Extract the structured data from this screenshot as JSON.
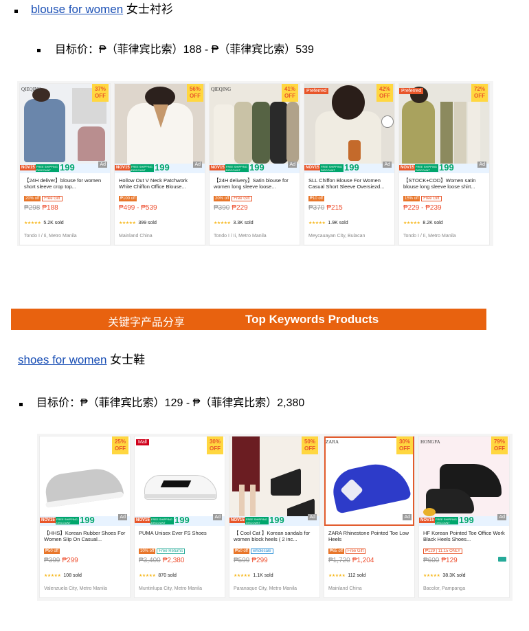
{
  "section1": {
    "link": "blouse for women",
    "title_cn": " 女士衬衫",
    "target": "目标价：₱（菲律宾比索）188 - ₱（菲律宾比索）539"
  },
  "products1": [
    {
      "tag": "QIEQING",
      "discount": "37%",
      "off": "OFF",
      "ad": "Ad",
      "n15": "NOV15",
      "ship": "FREE SHIPPING DISCOUNT",
      "n199": "199",
      "name": "【24H deliver】blouse for women short sleeve crop top...",
      "b1": "20% off",
      "b2": "Free Gift",
      "old": "₱298",
      "new": "₱188",
      "stars": "★★★★★",
      "sold": "5.2K sold",
      "loc": "Tondo I / Ii, Metro Manila"
    },
    {
      "tag": "",
      "discount": "56%",
      "off": "OFF",
      "ad": "Ad",
      "n15": "NOV15",
      "ship": "FREE SHIPPING DISCOUNT",
      "n199": "199",
      "name": "Hollow Out V Neck Patchwork White Chiffon Office Blouse...",
      "b1": "₱100 off",
      "b2": "",
      "old": "",
      "new": "₱499 - ₱539",
      "stars": "★★★★★",
      "sold": "399 sold",
      "loc": "Mainland China"
    },
    {
      "tag": "QIEQING",
      "discount": "41%",
      "off": "OFF",
      "ad": "Ad",
      "n15": "NOV15",
      "ship": "FREE SHIPPING DISCOUNT",
      "n199": "199",
      "name": "【24H delivery】Satin blouse for women long sleeve loose...",
      "b1": "20% off",
      "b2": "Free Gift",
      "old": "₱390",
      "new": "₱229",
      "stars": "★★★★★",
      "sold": "3.3K sold",
      "loc": "Tondo I / Ii, Metro Manila"
    },
    {
      "tag": "Preferred",
      "discount": "42%",
      "off": "OFF",
      "ad": "Ad",
      "n15": "NOV15",
      "ship": "FREE SHIPPING DISCOUNT",
      "n199": "199",
      "name": "SLL Chiffon Blouse For Women Casual Short Sleeve Oversiezd...",
      "b1": "₱10 off",
      "b2": "",
      "old": "₱370",
      "new": "₱215",
      "stars": "★★★★★",
      "sold": "1.9K sold",
      "loc": "Meycauayan City, Bulacan"
    },
    {
      "tag": "Preferred",
      "discount": "72%",
      "off": "OFF",
      "ad": "Ad",
      "n15": "NOV15",
      "ship": "FREE SHIPPING DISCOUNT",
      "n199": "199",
      "name": "【STOCK+COD】Women satin blouse long sleeve loose shirt...",
      "b1": "15% off",
      "b2": "Free Gift",
      "old": "",
      "new": "₱229 - ₱239",
      "stars": "★★★★★",
      "sold": "8.2K sold",
      "loc": "Tondo I / Ii, Metro Manila"
    }
  ],
  "banner": {
    "cn": "关键字产品分享",
    "en": "Top Keywords Products"
  },
  "section2": {
    "link": "shoes for women",
    "title_cn": " 女士鞋",
    "target": "目标价：₱（菲律宾比索）129 - ₱（菲律宾比索）2,380"
  },
  "products2": [
    {
      "tag": "",
      "discount": "25%",
      "off": "OFF",
      "ad": "Ad",
      "n15": "NOV15",
      "ship": "FREE SHIPPING DISCOUNT",
      "n199": "199",
      "name": "【HHS】Korean Rubber Shoes For Women Slip On Casual...",
      "b1": "₱50 off",
      "b2": "",
      "old": "₱399",
      "new": "₱299",
      "stars": "★★★★★",
      "sold": "108 sold",
      "loc": "Valenzuela City, Metro Manila"
    },
    {
      "tag": "Mall",
      "discount": "30%",
      "off": "OFF",
      "ad": "Ad",
      "n15": "NOV15",
      "ship": "FREE SHIPPING DISCOUNT",
      "n199": "199",
      "name": "PUMA Unisex Ever FS Shoes",
      "b1": "10% off",
      "b2": "Free Returns",
      "old": "₱3,400",
      "new": "₱2,380",
      "stars": "★★★★★",
      "sold": "870 sold",
      "loc": "Muntinlupa City, Metro Manila"
    },
    {
      "tag": "",
      "discount": "50%",
      "off": "OFF",
      "ad": "Ad",
      "n15": "NOV15",
      "ship": "FREE SHIPPING DISCOUNT",
      "n199": "199",
      "name": "【 Cool Cat 】Korean sandals for women block heels ( 2 inc...",
      "b1": "₱50 off",
      "b2": "wholesale",
      "old": "₱599",
      "new": "₱299",
      "stars": "★★★★★",
      "sold": "1.1K sold",
      "loc": "Paranaque City, Metro Manila"
    },
    {
      "tag": "ZARA",
      "discount": "30%",
      "off": "OFF",
      "ad": "Ad",
      "n15": "",
      "ship": "",
      "n199": "",
      "name": "ZARA Rhinestone Pointed Toe Low Heels",
      "b1": "₱65 off",
      "b2": "Free Gift",
      "old": "₱1,720",
      "new": "₱1,204",
      "stars": "★★★★★",
      "sold": "112 sold",
      "loc": "Mainland China"
    },
    {
      "tag": "HONGFA",
      "discount": "79%",
      "off": "OFF",
      "ad": "Ad",
      "n15": "NOV15",
      "ship": "FREE SHIPPING DISCOUNT",
      "n199": "199",
      "name": "HF Korean Pointed Toe Office Work Black Heels Shoes...",
      "b1": "",
      "b2": "₱129 | 11.15 ONLY",
      "old": "₱600",
      "new": "₱129",
      "stars": "★★★★★",
      "sold": "38.3K sold",
      "loc": "Bacolor, Pampanga"
    }
  ]
}
